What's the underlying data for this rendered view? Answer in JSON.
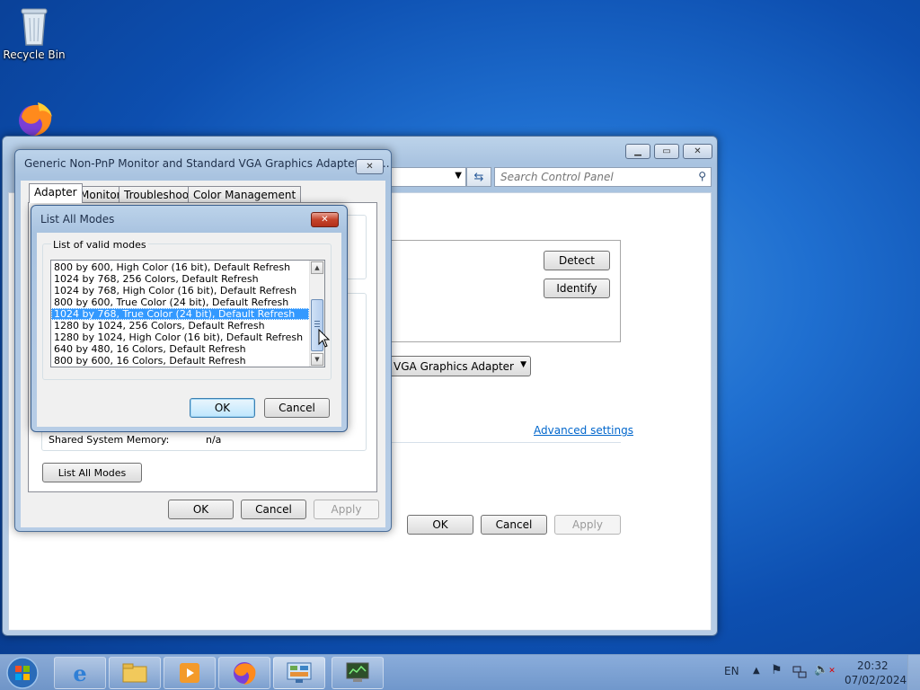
{
  "desktop": {
    "recycle_bin_label": "Recycle Bin"
  },
  "control_panel": {
    "search_placeholder": "Search Control Panel",
    "detect_label": "Detect",
    "identify_label": "Identify",
    "display_select_value": "rd VGA Graphics Adapter",
    "advanced_settings_label": "Advanced settings",
    "ok_label": "OK",
    "cancel_label": "Cancel",
    "apply_label": "Apply"
  },
  "properties": {
    "title": "Generic Non-PnP Monitor and Standard VGA Graphics Adapter Pro...",
    "tabs": [
      "Adapter",
      "Monitor",
      "Troubleshoot",
      "Color Management"
    ],
    "shared_memory_label": "Shared System Memory:",
    "shared_memory_value": "n/a",
    "list_all_modes_label": "List All Modes",
    "ok_label": "OK",
    "cancel_label": "Cancel",
    "apply_label": "Apply"
  },
  "modes_dialog": {
    "title": "List All Modes",
    "group_label": "List of valid modes",
    "modes": [
      "800 by 600, High Color (16 bit), Default Refresh",
      "1024 by 768, 256 Colors, Default Refresh",
      "1024 by 768, High Color (16 bit), Default Refresh",
      "800 by 600, True Color (24 bit), Default Refresh",
      "1024 by 768, True Color (24 bit), Default Refresh",
      "1280 by 1024, 256 Colors, Default Refresh",
      "1280 by 1024, High Color (16 bit), Default Refresh",
      "640 by 480, 16 Colors, Default Refresh",
      "800 by 600, 16 Colors, Default Refresh"
    ],
    "selected_index": 4,
    "ok_label": "OK",
    "cancel_label": "Cancel"
  },
  "taskbar": {
    "language": "EN",
    "time": "20:32",
    "date": "07/02/2024",
    "apps": [
      "start-orb-icon",
      "internet-explorer-icon",
      "file-explorer-icon",
      "media-player-icon",
      "firefox-icon",
      "control-panel-icon",
      "display-settings-icon"
    ]
  },
  "colors": {
    "selection": "#3399ff",
    "link": "#0066cc",
    "close_button": "#c4432a"
  }
}
